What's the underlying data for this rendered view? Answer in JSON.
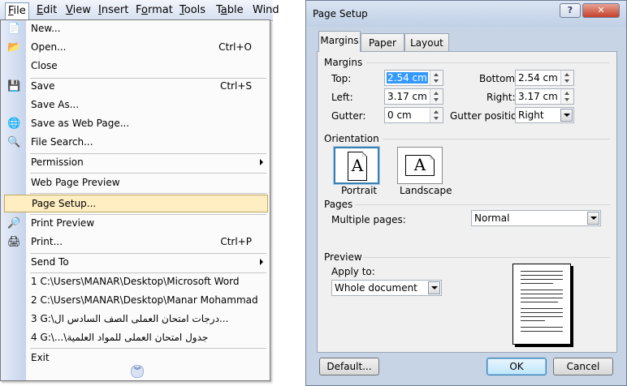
{
  "menubar": {
    "items": [
      {
        "label": "File",
        "access": "F",
        "rest": "ile"
      },
      {
        "label": "Edit",
        "access": "E",
        "rest": "dit"
      },
      {
        "label": "View",
        "access": "V",
        "rest": "iew"
      },
      {
        "label": "Insert",
        "access": "I",
        "rest": "nsert"
      },
      {
        "label": "Format",
        "access": "o",
        "pre": "F",
        "rest": "rmat"
      },
      {
        "label": "Tools",
        "access": "T",
        "rest": "ools"
      },
      {
        "label": "Table",
        "access": "a",
        "pre": "T",
        "rest": "ble"
      },
      {
        "label": "Wind",
        "access": "",
        "rest": "Wind"
      }
    ]
  },
  "file_menu": {
    "new": "New...",
    "open": "Open...",
    "open_shortcut": "Ctrl+O",
    "close": "Close",
    "save": "Save",
    "save_shortcut": "Ctrl+S",
    "save_as": "Save As...",
    "save_web": "Save as Web Page...",
    "file_search": "File Search...",
    "permission": "Permission",
    "web_preview": "Web Page Preview",
    "page_setup": "Page Setup...",
    "print_preview": "Print Preview",
    "print": "Print...",
    "print_shortcut": "Ctrl+P",
    "send_to": "Send To",
    "recent_1": "1 C:\\Users\\MANAR\\Desktop\\Microsoft Word",
    "recent_2": "2 C:\\Users\\MANAR\\Desktop\\Manar Mohammad",
    "recent_3": "3 G:\\درجات امتحان العملى الصف السادس ال...",
    "recent_4": "4 G:\\...\\جدول امتحان العملى للمواد العلمية",
    "exit": "Exit",
    "expand_icon": "chevron-double-down-icon"
  },
  "dialog": {
    "title": "Page Setup",
    "help": "?",
    "close": "✕",
    "tabs": [
      "Margins",
      "Paper",
      "Layout"
    ],
    "margins_group": "Margins",
    "top_label": "Top:",
    "top_value": "2.54 cm",
    "bottom_label": "Bottom:",
    "bottom_value": "2.54 cm",
    "left_label": "Left:",
    "left_value": "3.17 cm",
    "right_label": "Right:",
    "right_value": "3.17 cm",
    "gutter_label": "Gutter:",
    "gutter_value": "0 cm",
    "gutter_pos_label": "Gutter position:",
    "gutter_pos_value": "Right",
    "orientation_group": "Orientation",
    "portrait": "Portrait",
    "landscape": "Landscape",
    "orient_glyph": "A",
    "pages_group": "Pages",
    "multiple_label": "Multiple pages:",
    "multiple_value": "Normal",
    "preview_group": "Preview",
    "apply_label": "Apply to:",
    "apply_value": "Whole document",
    "default_button": "Default...",
    "ok_button": "OK",
    "cancel_button": "Cancel"
  },
  "colors": {
    "menu_highlight": "#ffeec2",
    "dialog_frame": "#c6d4e6",
    "selection": "#3399ff",
    "ok_button": "#bee6fd"
  }
}
